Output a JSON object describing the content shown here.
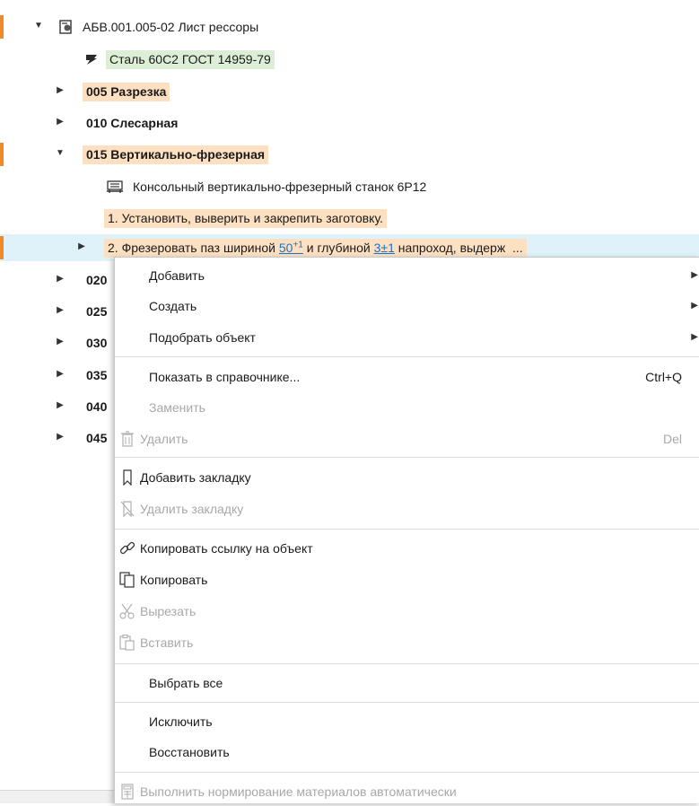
{
  "tree": {
    "root": {
      "label": "АБВ.001.005-02 Лист рессоры"
    },
    "material": {
      "label": "Сталь 60С2 ГОСТ 14959-79"
    },
    "ops": [
      {
        "label": "005 Разрезка"
      },
      {
        "label": "010 Слесарная"
      },
      {
        "label": "015 Вертикально-фрезерная"
      }
    ],
    "machine": {
      "label": "Консольный вертикально-фрезерный станок 6Р12"
    },
    "step1": {
      "label": "1. Установить, выверить и закрепить заготовку."
    },
    "step2": {
      "part1": "2. Фрезеровать паз шириной ",
      "dim1": "50",
      "dim1_tol": "+1",
      "part2": " и глубиной ",
      "dim2": "3±1",
      "part3": " напроход, выдерж",
      "ellipsis": "..."
    },
    "partial_ops": [
      "020",
      "025",
      "030",
      "035",
      "040",
      "045"
    ]
  },
  "menu": {
    "add": "Добавить",
    "create": "Создать",
    "pick_object": "Подобрать объект",
    "show_in_reference": "Показать в справочнике...",
    "show_in_reference_shortcut": "Ctrl+Q",
    "replace": "Заменить",
    "delete": "Удалить",
    "delete_shortcut": "Del",
    "add_bookmark": "Добавить закладку",
    "remove_bookmark": "Удалить закладку",
    "copy_link": "Копировать ссылку на объект",
    "copy": "Копировать",
    "cut": "Вырезать",
    "paste": "Вставить",
    "select_all": "Выбрать все",
    "exclude": "Исключить",
    "restore": "Восстановить",
    "auto_norm": "Выполнить нормирование материалов автоматически"
  },
  "colors": {
    "marker": "#f08a24",
    "orange_highlight": "#fde0c2",
    "green_highlight": "#dcefd6",
    "selected_row": "#dff2f9",
    "link": "#1a73c9"
  }
}
